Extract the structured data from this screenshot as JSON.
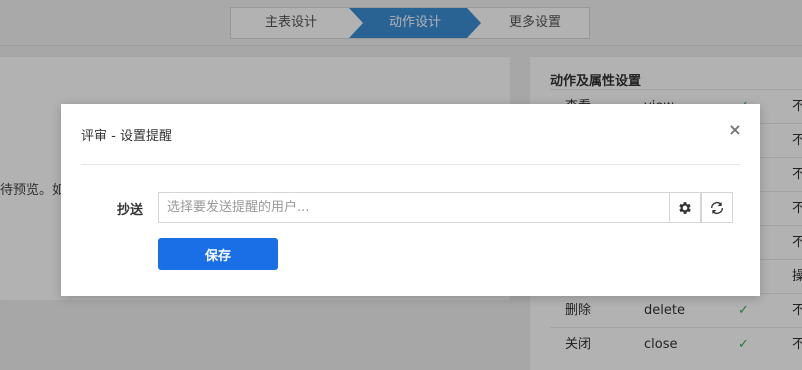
{
  "wizard": {
    "steps": [
      "主表设计",
      "动作设计",
      "更多设置"
    ],
    "active_index": 1
  },
  "left_panel": {
    "partial_text": "待预览。如氢"
  },
  "right_panel": {
    "title": "动作及属性设置",
    "rows": [
      {
        "name": "查看",
        "code": "view",
        "checked": true,
        "extra": "不"
      },
      {
        "name": "",
        "code": "",
        "checked": false,
        "extra": "不"
      },
      {
        "name": "",
        "code": "",
        "checked": false,
        "extra": "不"
      },
      {
        "name": "",
        "code": "",
        "checked": false,
        "extra": "不"
      },
      {
        "name": "",
        "code": "",
        "checked": false,
        "extra": "不"
      },
      {
        "name": "",
        "code": "",
        "checked": false,
        "extra": "操"
      },
      {
        "name": "删除",
        "code": "delete",
        "checked": true,
        "extra": "不"
      },
      {
        "name": "关闭",
        "code": "close",
        "checked": true,
        "extra": "不"
      }
    ]
  },
  "modal": {
    "title": "评审 - 设置提醒",
    "close_symbol": "×",
    "field": {
      "label": "抄送",
      "placeholder": "选择要发送提醒的用户...",
      "value": ""
    },
    "gear_icon": "gear-icon",
    "refresh_icon": "refresh-icon",
    "save_label": "保存"
  },
  "colors": {
    "primary": "#1a6fe6",
    "active_step": "#3a8ed4",
    "check": "#3aaa5a",
    "overlay": "rgba(0,0,0,0.30)"
  }
}
